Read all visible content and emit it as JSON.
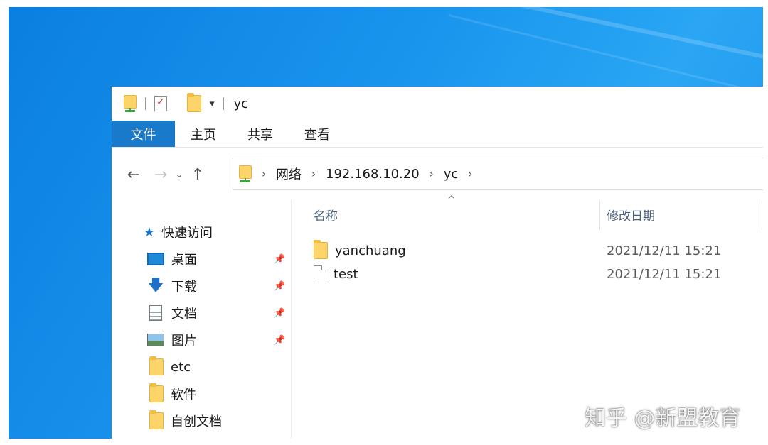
{
  "window": {
    "title": "yc",
    "qa_dropdown": "▾"
  },
  "ribbon": {
    "tabs": [
      {
        "label": "文件",
        "active": true
      },
      {
        "label": "主页",
        "active": false
      },
      {
        "label": "共享",
        "active": false
      },
      {
        "label": "查看",
        "active": false
      }
    ]
  },
  "nav": {
    "back": "←",
    "forward": "→",
    "recent": "⌄",
    "up": "↑",
    "breadcrumb": [
      "网络",
      "192.168.10.20",
      "yc"
    ],
    "separator": "›"
  },
  "sidebar": {
    "quick_access": "快速访问",
    "items": [
      {
        "label": "桌面",
        "icon": "desktop-icon",
        "pinned": true
      },
      {
        "label": "下载",
        "icon": "download-icon",
        "pinned": true
      },
      {
        "label": "文档",
        "icon": "document-icon",
        "pinned": true
      },
      {
        "label": "图片",
        "icon": "picture-icon",
        "pinned": true
      },
      {
        "label": "etc",
        "icon": "folder-icon",
        "pinned": false
      },
      {
        "label": "软件",
        "icon": "folder-icon",
        "pinned": false
      },
      {
        "label": "自创文档",
        "icon": "folder-icon",
        "pinned": false
      }
    ],
    "pin_glyph": "📌"
  },
  "content": {
    "columns": {
      "name": "名称",
      "modified": "修改日期"
    },
    "sort_indicator": "^",
    "files": [
      {
        "name": "yanchuang",
        "type": "folder",
        "modified": "2021/12/11 15:21"
      },
      {
        "name": "test",
        "type": "file",
        "modified": "2021/12/11 15:21"
      }
    ]
  },
  "watermark": "知乎 @新盟教育"
}
